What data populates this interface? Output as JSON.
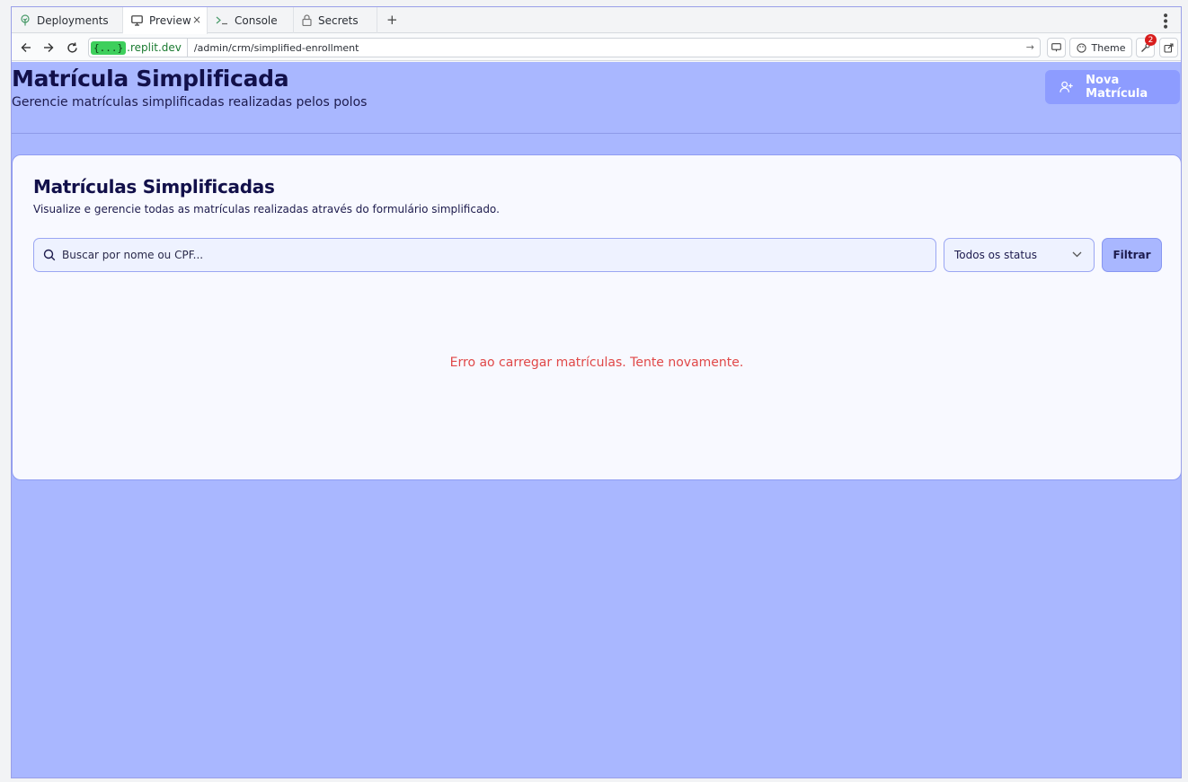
{
  "tabs": [
    {
      "label": "Deployments",
      "icon": "tree-icon"
    },
    {
      "label": "Preview",
      "icon": "monitor-icon",
      "active": true
    },
    {
      "label": "Console",
      "icon": "terminal-icon"
    },
    {
      "label": "Secrets",
      "icon": "lock-icon"
    }
  ],
  "tab_close": "×",
  "new_tab": "+",
  "address": {
    "domain_badge": "{...}",
    "domain": ".replit.dev",
    "path": "/admin/crm/simplified-enrollment",
    "theme_label": "Theme",
    "notifications_count": "2"
  },
  "header": {
    "title": "Matrícula Simplificada",
    "subtitle": "Gerencie matrículas simplificadas realizadas pelos polos",
    "new_button": "Nova Matrícula"
  },
  "card": {
    "title": "Matrículas Simplificadas",
    "subtitle": "Visualize e gerencie todas as matrículas realizadas através do formulário simplificado.",
    "search_placeholder": "Buscar por nome ou CPF...",
    "status_select": "Todos os status",
    "filter_button": "Filtrar",
    "error_message": "Erro ao carregar matrículas. Tente novamente."
  },
  "colors": {
    "page_bg": "#a9b7ff",
    "accent": "#8d9cff",
    "error": "#e04848",
    "title": "#12104a"
  }
}
